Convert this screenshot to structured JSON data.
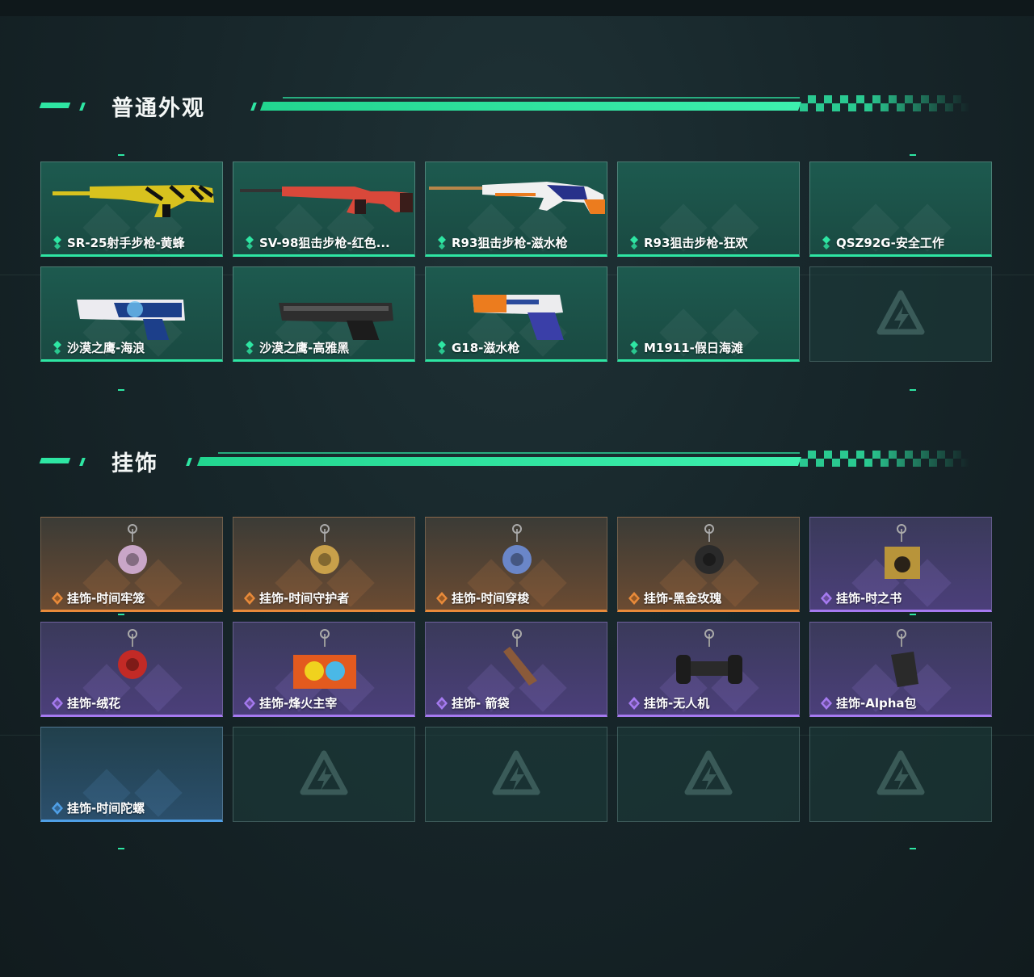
{
  "sections": [
    {
      "title": "普通外观",
      "items": [
        {
          "label": "SR-25射手步枪-黄蜂",
          "rarity": "green",
          "icon": "sniper-rifle-yellow-icon"
        },
        {
          "label": "SV-98狙击步枪-红色...",
          "rarity": "green",
          "icon": "sniper-rifle-red-icon"
        },
        {
          "label": "R93狙击步枪-滋水枪",
          "rarity": "green",
          "icon": "sniper-rifle-water-icon"
        },
        {
          "label": "R93狙击步枪-狂欢",
          "rarity": "green",
          "icon": ""
        },
        {
          "label": "QSZ92G-安全工作",
          "rarity": "green",
          "icon": ""
        },
        {
          "label": "沙漠之鹰-海浪",
          "rarity": "green",
          "icon": "pistol-wave-icon"
        },
        {
          "label": "沙漠之鹰-高雅黑",
          "rarity": "green",
          "icon": "pistol-black-icon"
        },
        {
          "label": "G18-滋水枪",
          "rarity": "green",
          "icon": "pistol-water-icon"
        },
        {
          "label": "M1911-假日海滩",
          "rarity": "green",
          "icon": ""
        },
        {
          "label": "",
          "rarity": "empty",
          "icon": "placeholder-logo-icon"
        }
      ]
    },
    {
      "title": "挂饰",
      "items": [
        {
          "label": "挂饰-时间牢笼",
          "rarity": "orange",
          "icon": "charm-cage-icon"
        },
        {
          "label": "挂饰-时间守护者",
          "rarity": "orange",
          "icon": "charm-guardian-icon"
        },
        {
          "label": "挂饰-时间穿梭",
          "rarity": "orange",
          "icon": "charm-shuttle-icon"
        },
        {
          "label": "挂饰-黑金玫瑰",
          "rarity": "orange",
          "icon": "charm-rose-gold-icon"
        },
        {
          "label": "挂饰-时之书",
          "rarity": "purple",
          "icon": "charm-book-icon"
        },
        {
          "label": "挂饰-绒花",
          "rarity": "purple",
          "icon": "charm-flower-icon"
        },
        {
          "label": "挂饰-烽火主宰",
          "rarity": "purple",
          "icon": "charm-container-icon"
        },
        {
          "label": "挂饰- 箭袋",
          "rarity": "purple",
          "icon": "charm-quiver-icon"
        },
        {
          "label": "挂饰-无人机",
          "rarity": "purple",
          "icon": "charm-drone-icon"
        },
        {
          "label": "挂饰-Alpha包",
          "rarity": "purple",
          "icon": "charm-alpha-bag-icon"
        },
        {
          "label": "挂饰-时间陀螺",
          "rarity": "blue",
          "icon": ""
        },
        {
          "label": "",
          "rarity": "empty",
          "icon": "placeholder-logo-icon"
        },
        {
          "label": "",
          "rarity": "empty",
          "icon": "placeholder-logo-icon"
        },
        {
          "label": "",
          "rarity": "empty",
          "icon": "placeholder-logo-icon"
        },
        {
          "label": "",
          "rarity": "empty",
          "icon": "placeholder-logo-icon"
        }
      ]
    }
  ],
  "colors": {
    "accent": "#2ee6a3",
    "green": "#2ee6a3",
    "orange": "#e88a3a",
    "purple": "#a57af0",
    "blue": "#4f9fe6"
  }
}
